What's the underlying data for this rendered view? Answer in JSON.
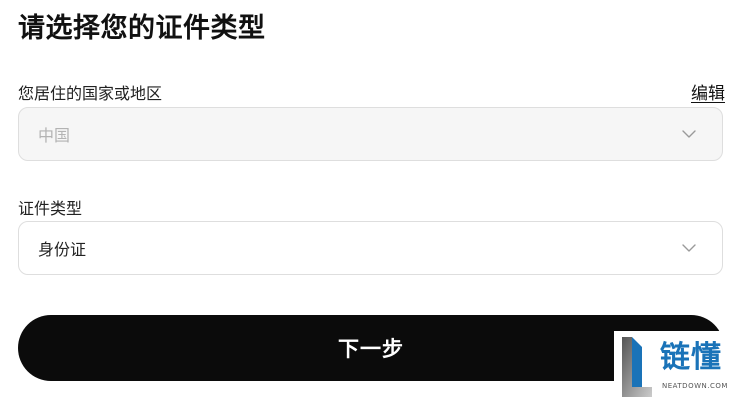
{
  "page": {
    "title": "请选择您的证件类型"
  },
  "country": {
    "label": "您居住的国家或地区",
    "edit_label": "编辑",
    "value": "中国",
    "icon": "chevron-down-icon"
  },
  "id_type": {
    "label": "证件类型",
    "value": "身份证",
    "icon": "chevron-down-icon"
  },
  "actions": {
    "next_label": "下一步"
  },
  "watermark": {
    "brand": "链懂",
    "domain": "NEATDOWN.COM"
  },
  "colors": {
    "button_bg": "#0b0b0b",
    "disabled_bg": "#f6f6f6",
    "border": "#dedede",
    "watermark_blue": "#1a73b8"
  }
}
